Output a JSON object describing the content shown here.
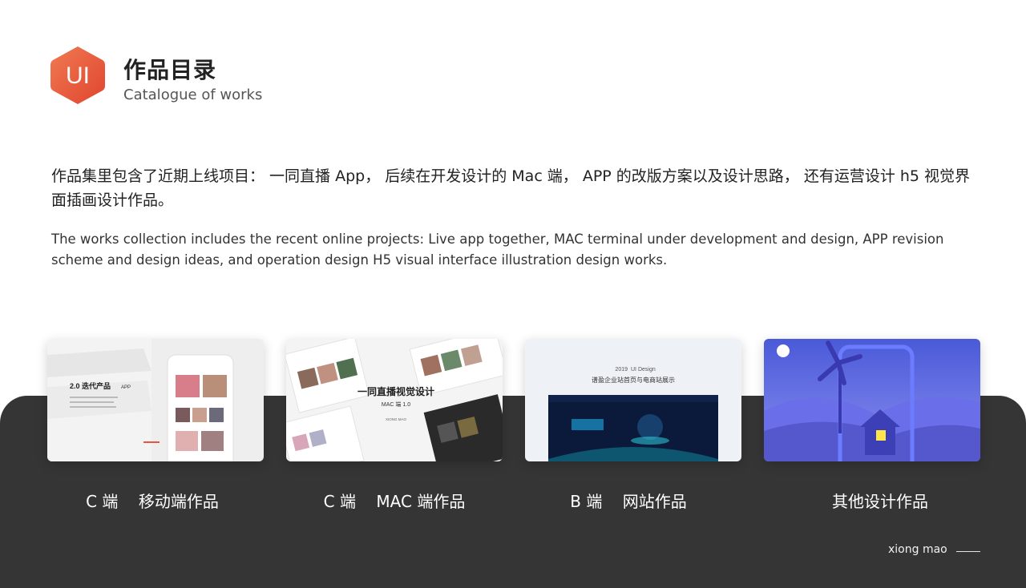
{
  "header": {
    "logo_text": "UI",
    "title": "作品目录",
    "subtitle": "Catalogue of works"
  },
  "intro": {
    "cn": "作品集里包含了近期上线项目： 一同直播 App， 后续在开发设计的 Mac 端， APP 的改版方案以及设计思路， 还有运营设计 h5 视觉界面插画设计作品。",
    "en": "The works collection includes the recent online projects: Live app together, MAC terminal under development and design, APP revision scheme and design ideas, and operation design H5 visual interface illustration design works."
  },
  "works": [
    {
      "caption": "C 端    移动端作品",
      "thumb": {
        "heading": "2.0 迭代产品",
        "tag": "APP"
      }
    },
    {
      "caption": "C 端    MAC 端作品",
      "thumb": {
        "heading": "一同直播视觉设计",
        "sub": "MAC 端 1.0",
        "credit": "XIONG MAO"
      }
    },
    {
      "caption": "B 端    网站作品",
      "thumb": {
        "year": "2019",
        "label": "UI  Design",
        "heading": "谱盈企业站首页与电商站展示"
      }
    },
    {
      "caption": "其他设计作品",
      "thumb": {}
    }
  ],
  "footer": {
    "signature": "xiong mao"
  },
  "colors": {
    "accent": "#e8553a",
    "panel": "#353535"
  }
}
